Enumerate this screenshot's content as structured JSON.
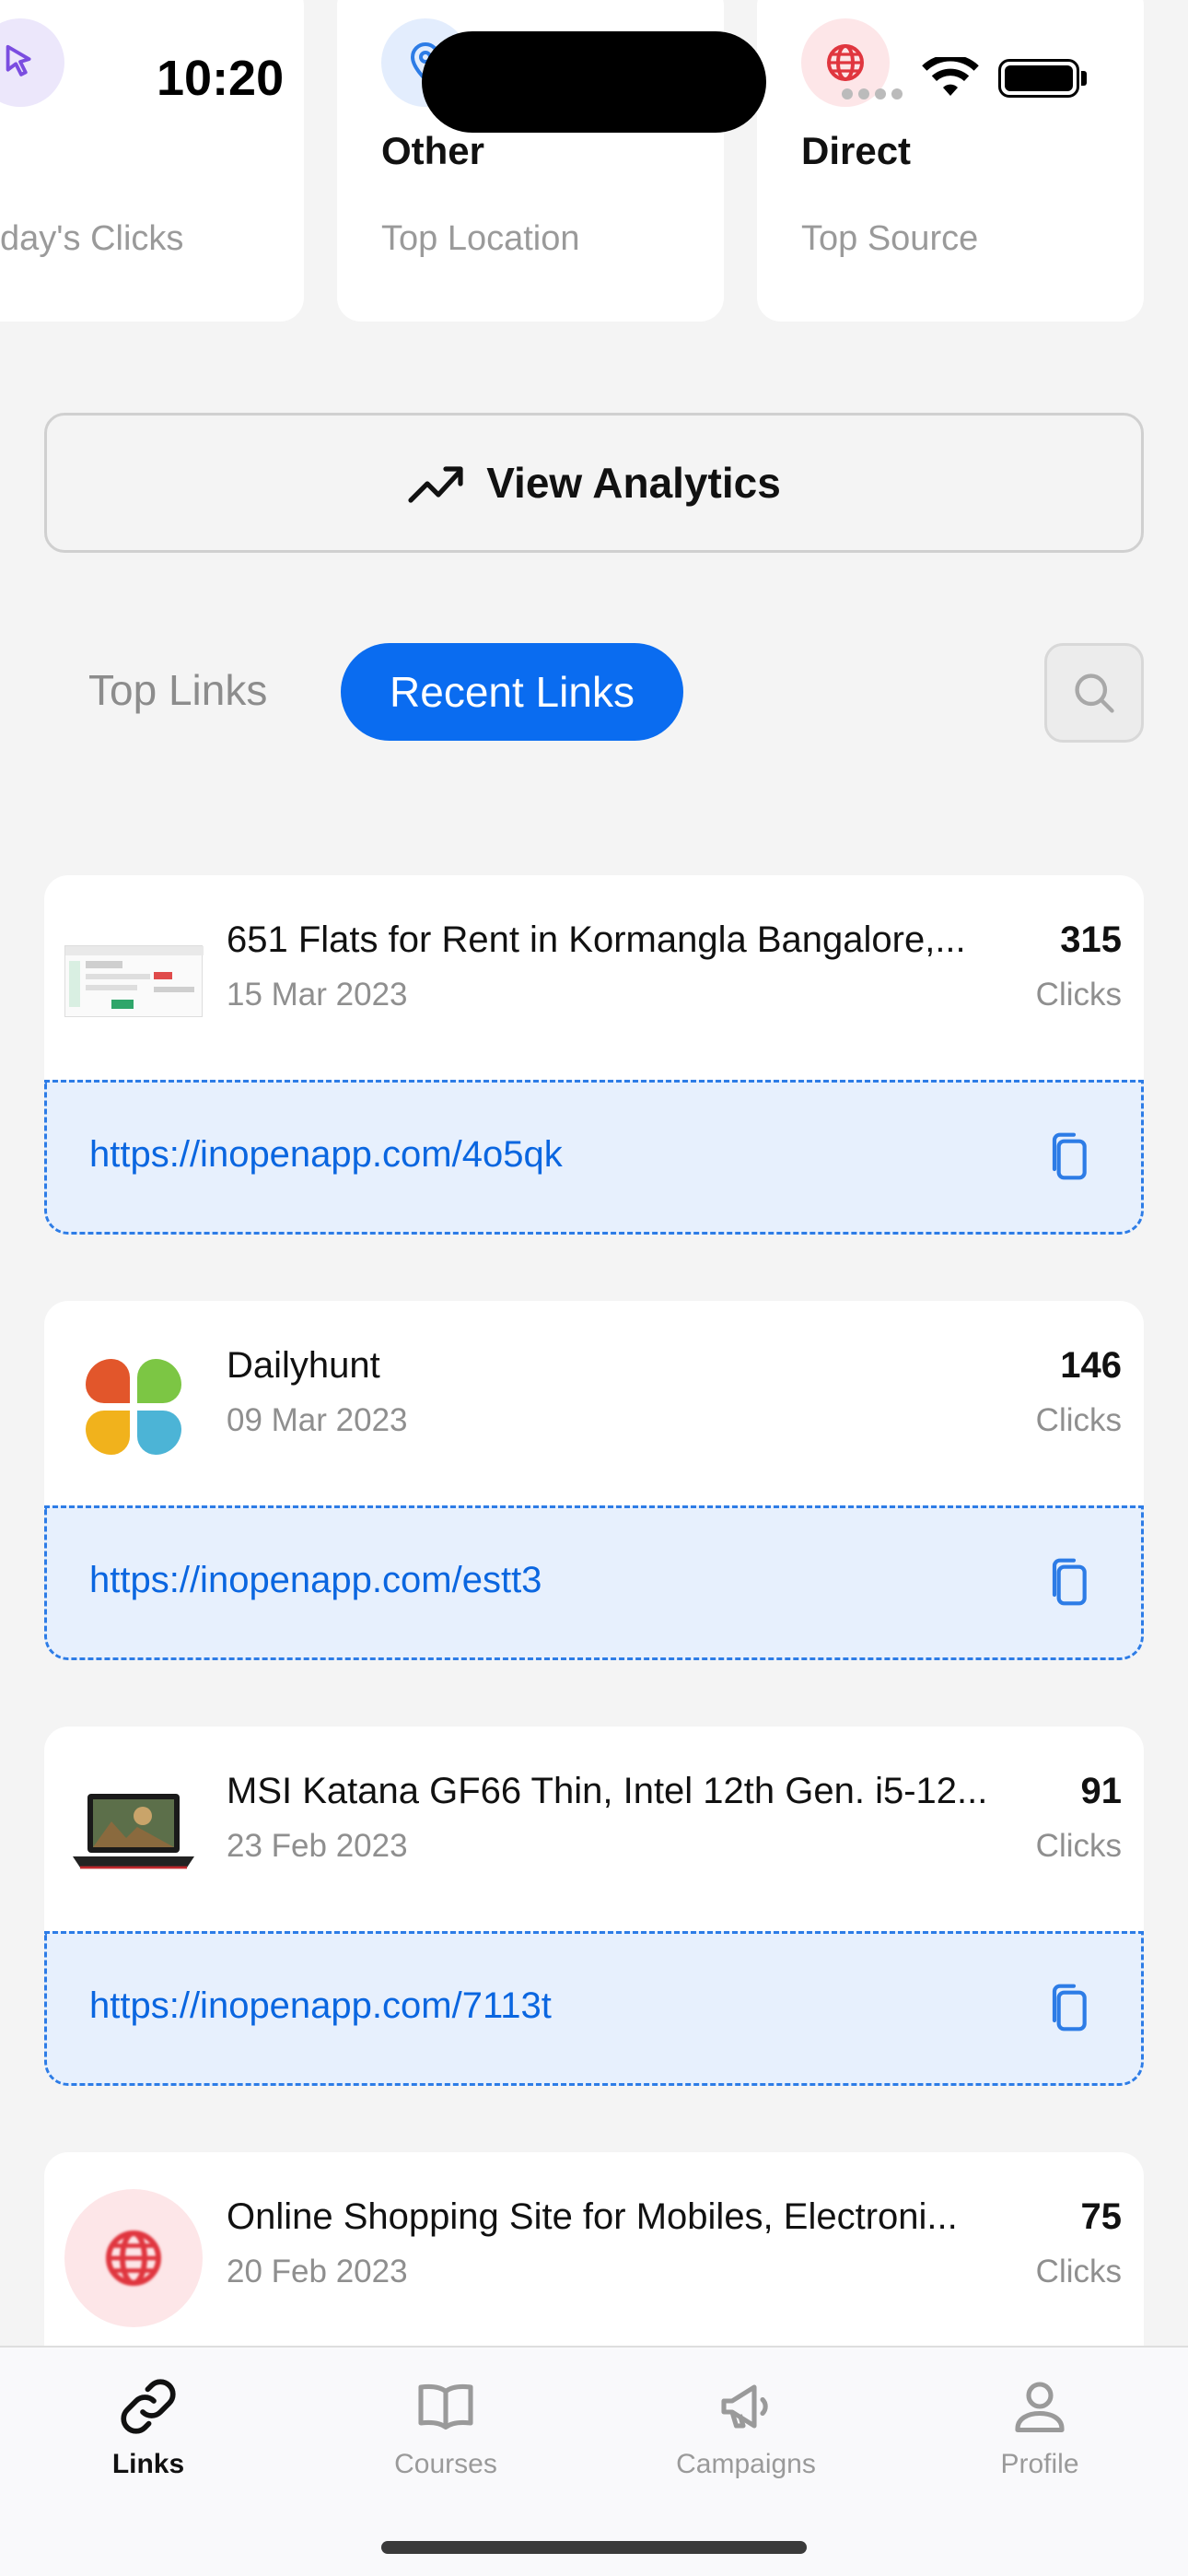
{
  "status_bar": {
    "time": "10:20"
  },
  "stats": [
    {
      "value": "",
      "label": "day's Clicks",
      "icon": "cursor-click-icon"
    },
    {
      "value": "Other",
      "label": "Top Location",
      "icon": "location-pin-icon"
    },
    {
      "value": "Direct",
      "label": "Top Source",
      "icon": "globe-icon"
    }
  ],
  "analytics_button": {
    "label": "View Analytics",
    "icon": "trend-up-icon"
  },
  "tabs": {
    "top": "Top Links",
    "recent": "Recent Links"
  },
  "search": {
    "icon": "search-icon"
  },
  "links": [
    {
      "title": "651   Flats for Rent in Kormangla Bangalore,...",
      "date": "15 Mar 2023",
      "clicks": "315",
      "clicks_label": "Clicks",
      "url": "https://inopenapp.com/4o5qk",
      "thumb": "website-screenshot-thumb"
    },
    {
      "title": "Dailyhunt",
      "date": "09 Mar 2023",
      "clicks": "146",
      "clicks_label": "Clicks",
      "url": "https://inopenapp.com/estt3",
      "thumb": "dailyhunt-logo"
    },
    {
      "title": "MSI Katana GF66 Thin, Intel 12th Gen. i5-12...",
      "date": "23 Feb 2023",
      "clicks": "91",
      "clicks_label": "Clicks",
      "url": "https://inopenapp.com/7113t",
      "thumb": "laptop-thumb"
    },
    {
      "title": "Online Shopping Site for Mobiles, Electroni...",
      "date": "20 Feb 2023",
      "clicks": "75",
      "clicks_label": "Clicks",
      "url": "",
      "thumb": "globe-thumb"
    }
  ],
  "nav": [
    {
      "label": "Links",
      "icon": "link-icon",
      "active": true
    },
    {
      "label": "Courses",
      "icon": "book-icon",
      "active": false
    },
    {
      "label": "Campaigns",
      "icon": "megaphone-icon",
      "active": false
    },
    {
      "label": "Profile",
      "icon": "user-icon",
      "active": false
    }
  ],
  "colors": {
    "accent": "#0a6cf0",
    "url_bg": "#e7f0fd",
    "link_text": "#0a66e0"
  }
}
